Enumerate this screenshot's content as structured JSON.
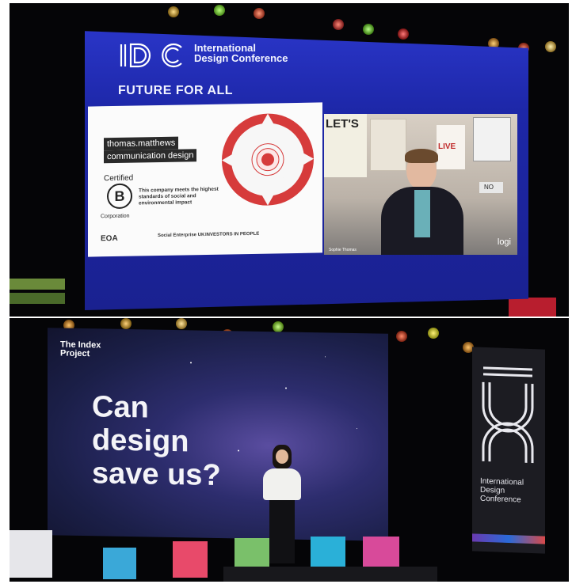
{
  "top_photo": {
    "brand_name": "International Design Conference",
    "brand_mark": "IDC",
    "tagline": "FUTURE FOR ALL",
    "slide": {
      "company_line1": "thomas.matthews",
      "company_line2": "communication design",
      "certified": "Certified",
      "b_letter": "B",
      "corporation": "Corporation",
      "certification_text": "This company meets the highest standards of social and environmental impact",
      "logo_eoa": "EOA",
      "logo_social_enterprise": "Social Enterprise UK",
      "logo_investors": "INVESTORS IN PEOPLE"
    },
    "video": {
      "speaker_name": "Sophie Thomas",
      "camera_logo": "logi",
      "poster_text_1": "LET'S",
      "poster_text_2": "LIVE",
      "sign_text": "NO"
    }
  },
  "bottom_photo": {
    "screen_label": "The Index Project",
    "headline": [
      "Can",
      "design",
      "save us?"
    ],
    "banner_text": "International Design Conference",
    "banner_mark": "IDC"
  },
  "colors": {
    "screen_blue": "#2a36c9",
    "wheel_red": "#d63b3b",
    "headline_white": "#f4f4f8"
  }
}
